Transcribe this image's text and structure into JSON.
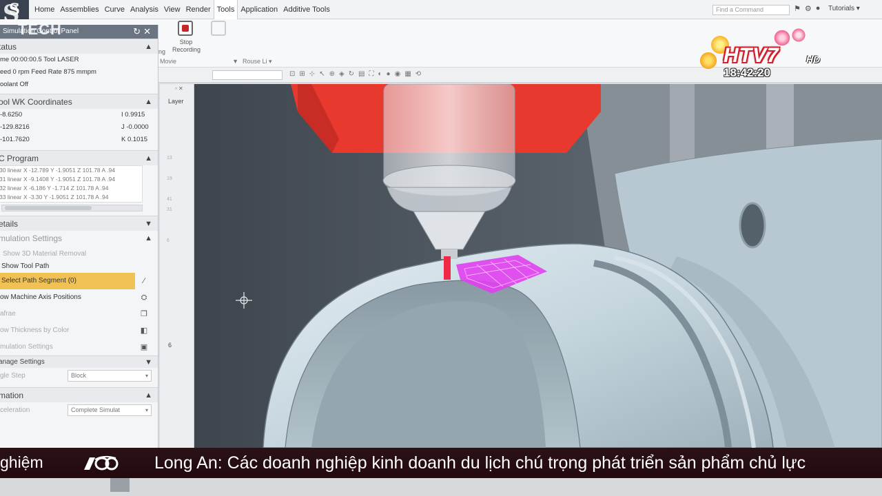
{
  "menu": {
    "tabs": [
      "Home",
      "Assemblies",
      "Curve",
      "Analysis",
      "View",
      "Render",
      "Tools",
      "Application",
      "Additive Tools"
    ],
    "active_tab": "Tools",
    "search_placeholder": "Find a Command",
    "tutorials_label": "Tutorials"
  },
  "ribbon": {
    "stop_label": "Stop",
    "recording_label": "Recording",
    "left_label": "ng",
    "movie_label": "Movie",
    "rouse_label": "Rouse Li"
  },
  "panel": {
    "title": "Simulation Control Panel",
    "status": {
      "header": "tatus",
      "rows": [
        "me 00:00:00.5 Tool LASER",
        "eed 0 rpm    Feed Rate 875 mmpm",
        "oolant Off"
      ]
    },
    "coords": {
      "header": "ool WK Coordinates",
      "rows": [
        {
          "left": "-8.6250",
          "right": "I 0.9915"
        },
        {
          "left": "-129.8216",
          "right": "J -0.0000"
        },
        {
          "left": "-101.7620",
          "right": "K 0.1015"
        }
      ]
    },
    "program": {
      "header": "C Program",
      "lines": [
        "30 linear X -12.789 Y -1.9051 Z 101.78 A .94",
        "31 linear X -9.1408 Y -1.9051 Z 101.78 A .94",
        "32 linear X -6.186 Y -1.714 Z 101.78 A .94",
        "33 linear X -3.30 Y -1.9051 Z 101.78 A .94"
      ]
    },
    "details_header": "etails",
    "sim_settings": {
      "header": "mulation Settings",
      "options": [
        {
          "label": "Show 3D Material Removal",
          "state": "dim",
          "icon": ""
        },
        {
          "label": "Show Tool Path",
          "state": "normal",
          "icon": ""
        },
        {
          "label": "Select Path Segment (0)",
          "state": "selected",
          "icon": "pencil-icon"
        },
        {
          "label": "ow Machine Axis Positions",
          "state": "normal",
          "icon": "axis-icon"
        },
        {
          "label": "afrae",
          "state": "dim",
          "icon": "copy-icon"
        },
        {
          "label": "ow Thickness by Color",
          "state": "dim",
          "icon": "color-icon"
        },
        {
          "label": "mulation Settings",
          "state": "dim",
          "icon": "settings-icon"
        }
      ]
    },
    "manage": {
      "header": "anage Settings",
      "step_label": "gle Step",
      "step_value": "Block"
    },
    "animation": {
      "header": "mation",
      "row_label": "celeration",
      "row_value": "Complete Simulat"
    }
  },
  "layer": {
    "header": "Layer",
    "numbers": [
      "13",
      "",
      "19",
      "",
      "41",
      "31",
      "",
      "",
      "6"
    ],
    "marker": "6"
  },
  "broadcast": {
    "brand_letter": "S",
    "brand_word": "TECH",
    "station": "HTV7",
    "hd": "HD",
    "time": "18:42:20",
    "ticker_left": "ghiệm",
    "ticker_text": "Long An: Các doanh nghiệp kinh doanh du lịch chú trọng phát triển sản phẩm chủ lực"
  },
  "colors": {
    "head_red": "#e8392f",
    "laser_magenta": "#e040f0",
    "pipe_blue": "#c4d5df",
    "selection": "#f0c256",
    "ticker_bg": "#2a1216"
  }
}
